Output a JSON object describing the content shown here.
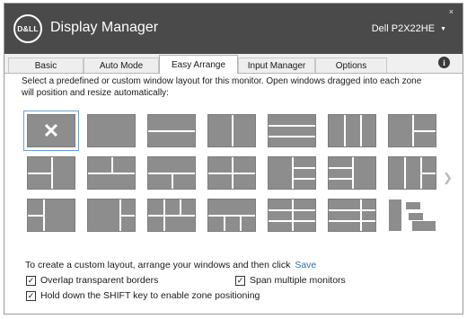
{
  "app": {
    "brand": "D&LL",
    "title": "Display Manager",
    "monitor": "Dell P2X22HE",
    "close_glyph": "×",
    "dropdown_glyph": "▼"
  },
  "tabs": [
    {
      "label": "Basic",
      "active": false
    },
    {
      "label": "Auto Mode",
      "active": false
    },
    {
      "label": "Easy Arrange",
      "active": true
    },
    {
      "label": "Input Manager",
      "active": false
    },
    {
      "label": "Options",
      "active": false
    }
  ],
  "info_glyph": "i",
  "description": "Select a predefined or custom window layout for this monitor.  Open windows dragged into each zone will position and resize automatically:",
  "layouts": {
    "selected_index": 0,
    "selected_glyph": "✕",
    "pages_icon": "chevron-right-icon"
  },
  "custom": {
    "text": "To create a custom layout, arrange your windows and then click",
    "save_label": "Save"
  },
  "options": {
    "overlap_label": "Overlap transparent borders",
    "overlap_checked": true,
    "span_label": "Span multiple monitors",
    "span_checked": true,
    "shift_label": "Hold down the SHIFT key to enable zone positioning",
    "shift_checked": true,
    "check_glyph": "✓"
  },
  "colors": {
    "titlebar": "#4a4a4a",
    "zone": "#8d8d8d",
    "selection": "#cfe2f5",
    "link": "#2f6db5"
  }
}
